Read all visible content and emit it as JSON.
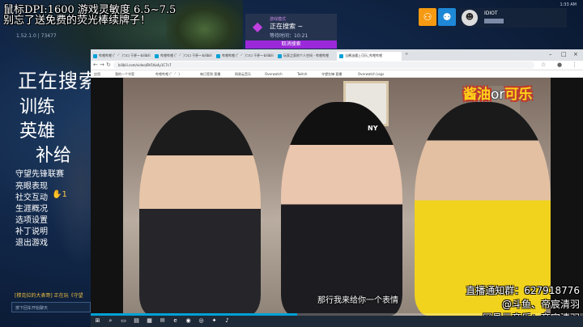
{
  "overlay": {
    "line1": "鼠标DPI:1600 游戏灵敏度 6.5~7.5",
    "line2": "别忘了送免费的荧光棒续牌子！",
    "version": "1.52.1.0 | 73477"
  },
  "game_menu": {
    "searching": "正在搜索",
    "training": "训练",
    "heroes": "英雄",
    "supply": "补给",
    "items": [
      "守望先锋联赛",
      "亮眼表现",
      "社交互动",
      "生涯概况",
      "选项设置",
      "补丁说明",
      "退出游戏"
    ],
    "social_badge": "1"
  },
  "chat": {
    "line": "[穆克拉的大表哥] 正在玩《守望",
    "input_placeholder": "按下回车开始聊天"
  },
  "search_panel": {
    "header": "游戏模式",
    "title": "正在搜索 ~",
    "wait_time": "等待时间：10:21",
    "cancel": "取消搜索"
  },
  "player": {
    "name": "IDIOT",
    "sub": "",
    "clock": "1:33 AM"
  },
  "browser": {
    "tabs": [
      {
        "label": "哔哩哔哩 (゜-゜)つロ 干杯~-bilibili",
        "active": false
      },
      {
        "label": "哔哩哔哩 (゜-゜)つロ 干杯~-bilibili",
        "active": false
      },
      {
        "label": "哔哩哔哩 (゜-゜)つロ 干杯~-bilibili",
        "active": false
      },
      {
        "label": "玩家之家的个人空间 - 哔哩哔哩",
        "active": false
      },
      {
        "label": "当酱油遇上可乐_哔哩哔哩",
        "active": true
      }
    ],
    "url": "bilibili.com/video/BV1Ko4y1C7c7",
    "bookmarks": [
      "应用",
      "我的一个书签",
      "哔哩哔哩 (゜-゜)",
      "每日签到·直播",
      "网易云音乐",
      "Overwatch",
      "Twitch",
      "守望先锋·直播",
      "Overwatch Logs"
    ]
  },
  "video": {
    "title_part1": "酱油",
    "title_or": "or",
    "title_part2": "可乐",
    "subtitle": "那行我来给你一个表情",
    "cap_logo": "NY",
    "progress": 0.42
  },
  "stream_info": {
    "line1": "直播通知群：627918776",
    "line2": "@斗鱼、帝宸清羽",
    "line3": "网易云音乐：帝宸清羽"
  },
  "taskbar": {
    "icons": [
      "windows-icon",
      "search-icon",
      "task-view-icon",
      "explorer-icon",
      "store-icon",
      "mail-icon",
      "edge-icon",
      "chrome-icon",
      "overwatch-icon",
      "battle-net-icon",
      "music-icon"
    ]
  },
  "colors": {
    "accent_purple": "#9b29d9",
    "social_orange": "#f59a12",
    "social_blue": "#1e88d6",
    "title_yellow": "#ffd21a"
  }
}
